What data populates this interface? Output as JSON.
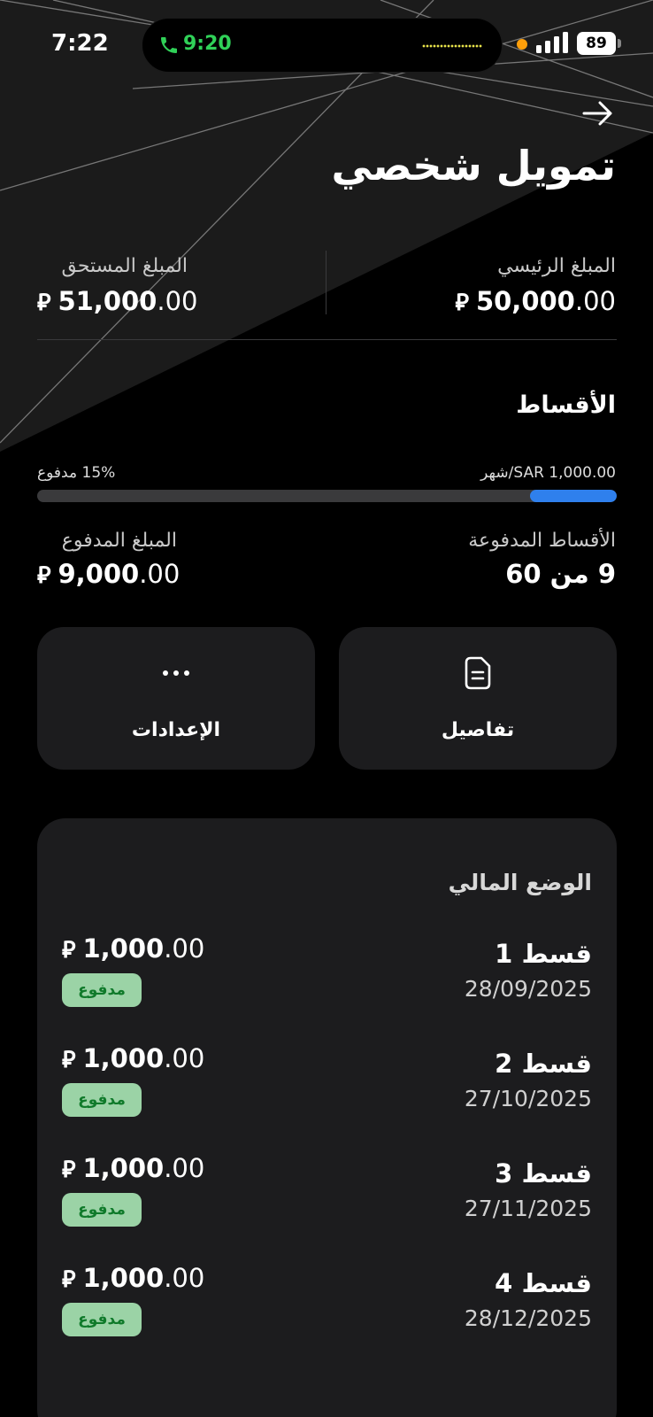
{
  "status_bar": {
    "time": "7:22",
    "call_time": "9:20",
    "battery": "89"
  },
  "header": {
    "back_icon": "arrow-right-icon",
    "title": "تمويل شخصي"
  },
  "summary": {
    "principal_label": "المبلغ الرئيسي",
    "principal_int": "50,000",
    "principal_dec": ".00",
    "due_label": "المبلغ المستحق",
    "due_int": "51,000",
    "due_dec": ".00",
    "currency_symbol": "⃁"
  },
  "installments": {
    "title": "الأقساط",
    "monthly_label": "SAR 1,000.00/شهر",
    "paid_percent_label": "15% مدفوع",
    "progress_fraction": 0.15,
    "paid_count_label": "الأقساط المدفوعة",
    "paid_count_value": "9 من 60",
    "paid_amount_label": "المبلغ المدفوع",
    "paid_amount_int": "9,000",
    "paid_amount_dec": ".00"
  },
  "actions": {
    "details_label": "تفاصيل",
    "details_icon": "document-icon",
    "settings_label": "الإعدادات",
    "settings_icon": "more-dots-icon"
  },
  "financial_status": {
    "title": "الوضع المالي",
    "rows": [
      {
        "name": "قسط 1",
        "date": "28/09/2025",
        "amount_int": "1,000",
        "amount_dec": ".00",
        "status": "مدفوع"
      },
      {
        "name": "قسط 2",
        "date": "27/10/2025",
        "amount_int": "1,000",
        "amount_dec": ".00",
        "status": "مدفوع"
      },
      {
        "name": "قسط 3",
        "date": "27/11/2025",
        "amount_int": "1,000",
        "amount_dec": ".00",
        "status": "مدفوع"
      },
      {
        "name": "قسط 4",
        "date": "28/12/2025",
        "amount_int": "1,000",
        "amount_dec": ".00",
        "status": "مدفوع"
      }
    ]
  },
  "colors": {
    "background": "#000000",
    "card": "#1c1c1e",
    "accent_blue": "#2f80ed",
    "call_green": "#30d158",
    "badge_bg": "#9bd3a6",
    "badge_text": "#0f7a2a"
  }
}
